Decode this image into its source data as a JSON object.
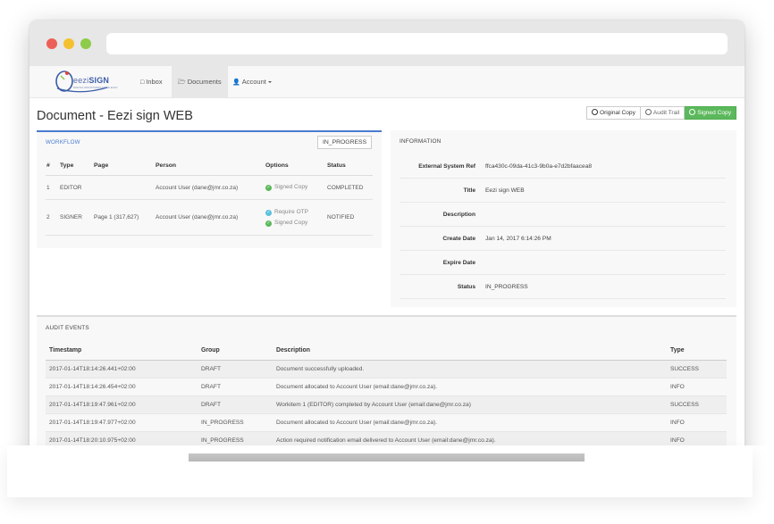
{
  "brand": {
    "logo_light": "eezi",
    "logo_bold": "SIGN",
    "logo_tagline": "DIGITAL SIGNATURES MADE EASY"
  },
  "nav": {
    "inbox": "Inbox",
    "documents": "Documents",
    "account": "Account"
  },
  "page": {
    "title": "Document - Eezi sign WEB"
  },
  "actions": {
    "original_copy": "Original Copy",
    "audit_trail": "Audit Trail",
    "signed_copy": "Signed Copy"
  },
  "workflow": {
    "title": "WORKFLOW",
    "status": "IN_PROGRESS",
    "columns": [
      "#",
      "Type",
      "Page",
      "Person",
      "Options",
      "Status"
    ],
    "rows": [
      {
        "num": "1",
        "type": "EDITOR",
        "page": "",
        "person": "Account User (dane@jmr.co.za)",
        "options": [
          "Signed Copy"
        ],
        "status": "COMPLETED"
      },
      {
        "num": "2",
        "type": "SIGNER",
        "page": "Page 1 (317,627)",
        "person": "Account User (dane@jmr.co.za)",
        "options": [
          "Require OTP",
          "Signed Copy"
        ],
        "status": "NOTIFIED"
      }
    ]
  },
  "information": {
    "title": "INFORMATION",
    "rows": [
      {
        "label": "External System Ref",
        "value": "ffca430c-09da-41c3-9b0a-e7d2bfaacea8"
      },
      {
        "label": "Title",
        "value": "Eezi sign WEB"
      },
      {
        "label": "Description",
        "value": ""
      },
      {
        "label": "Create Date",
        "value": "Jan 14, 2017 6:14:26 PM"
      },
      {
        "label": "Expire Date",
        "value": ""
      },
      {
        "label": "Status",
        "value": "IN_PROGRESS"
      }
    ]
  },
  "audit": {
    "title": "AUDIT EVENTS",
    "columns": [
      "Timestamp",
      "Group",
      "Description",
      "Type"
    ],
    "rows": [
      {
        "timestamp": "2017-01-14T18:14:26.441+02:00",
        "group": "DRAFT",
        "description": "Document successfully uploaded.",
        "type": "SUCCESS"
      },
      {
        "timestamp": "2017-01-14T18:14:26.454+02:00",
        "group": "DRAFT",
        "description": "Document allocated to Account User (email:dane@jmr.co.za).",
        "type": "INFO"
      },
      {
        "timestamp": "2017-01-14T18:19:47.961+02:00",
        "group": "DRAFT",
        "description": "Workitem 1 (EDITOR) completed by Account User (email:dane@jmr.co.za)",
        "type": "SUCCESS"
      },
      {
        "timestamp": "2017-01-14T18:19:47.977+02:00",
        "group": "IN_PROGRESS",
        "description": "Document allocated to Account User (email:dane@jmr.co.za).",
        "type": "INFO"
      },
      {
        "timestamp": "2017-01-14T18:20:10.975+02:00",
        "group": "IN_PROGRESS",
        "description": "Action required notification email delivered to Account User (email:dane@jmr.co.za).",
        "type": "INFO"
      }
    ]
  },
  "colors": {
    "accent_blue": "#4a7bd0",
    "success_green": "#5cb85c",
    "info_blue": "#5bc0de"
  }
}
